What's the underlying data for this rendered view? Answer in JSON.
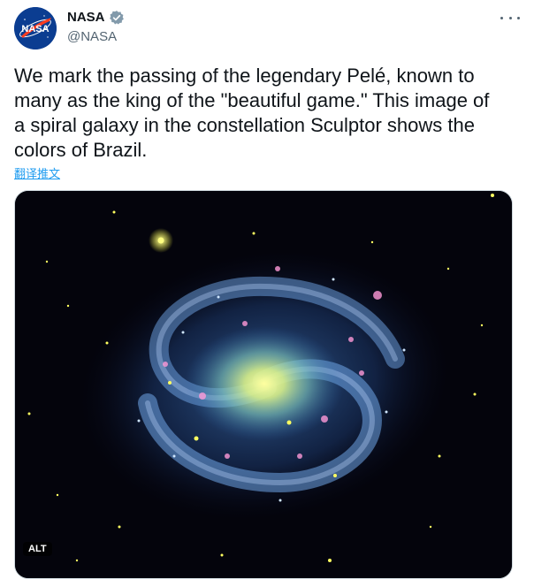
{
  "account": {
    "display_name": "NASA",
    "handle": "@NASA",
    "avatar_text": "NASA",
    "verified": true
  },
  "tweet": {
    "text": "We mark the passing of the legendary Pelé, known to\nmany as the king of the \"beautiful game.\" This image of\na spiral galaxy in the constellation Sculptor shows the\ncolors of Brazil.",
    "translate_label": "翻译推文"
  },
  "media": {
    "alt_label": "ALT"
  },
  "colors": {
    "link": "#1d9bf0",
    "verified_badge": "#829aab",
    "nasa_blue": "#0b3d91",
    "nasa_red": "#fc3d21"
  }
}
